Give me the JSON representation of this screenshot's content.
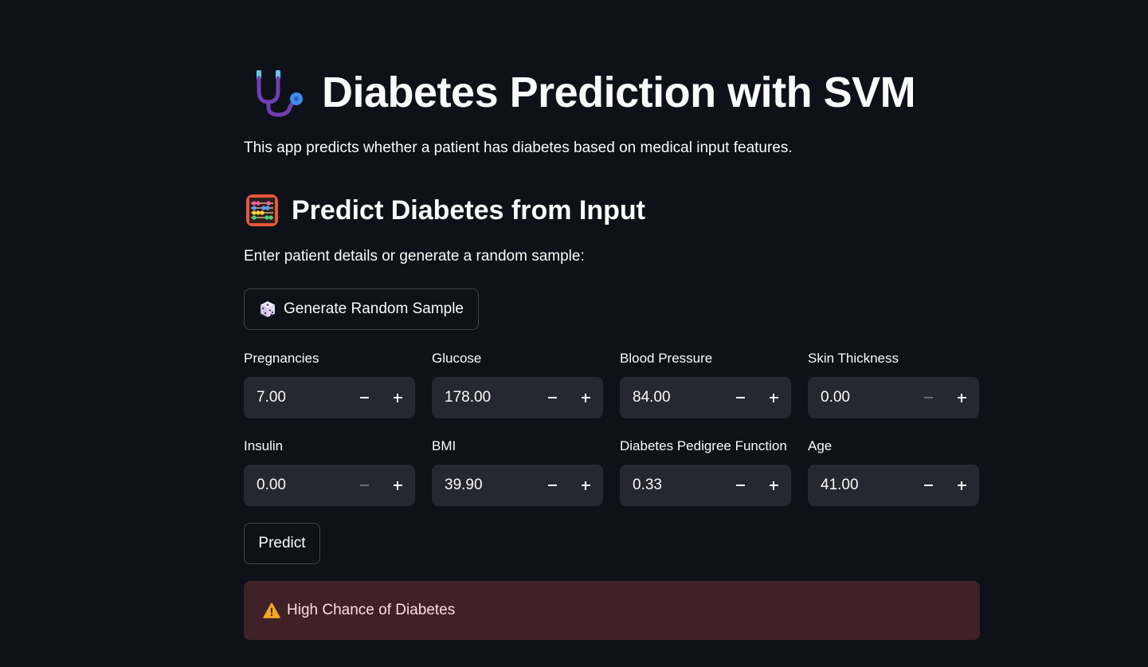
{
  "header": {
    "title": "Diabetes Prediction with SVM",
    "title_icon": "stethoscope-icon",
    "intro": "This app predicts whether a patient has diabetes based on medical input features."
  },
  "section": {
    "title": "Predict Diabetes from Input",
    "title_icon": "abacus-icon",
    "instructions": "Enter patient details or generate a random sample:"
  },
  "buttons": {
    "random_label": "Generate Random Sample",
    "random_icon": "dice-icon",
    "predict_label": "Predict"
  },
  "fields": [
    {
      "label": "Pregnancies",
      "value": "7.00",
      "minus_disabled": false
    },
    {
      "label": "Glucose",
      "value": "178.00",
      "minus_disabled": false
    },
    {
      "label": "Blood Pressure",
      "value": "84.00",
      "minus_disabled": false
    },
    {
      "label": "Skin Thickness",
      "value": "0.00",
      "minus_disabled": true
    },
    {
      "label": "Insulin",
      "value": "0.00",
      "minus_disabled": true
    },
    {
      "label": "BMI",
      "value": "39.90",
      "minus_disabled": false
    },
    {
      "label": "Diabetes Pedigree Function",
      "value": "0.33",
      "minus_disabled": false
    },
    {
      "label": "Age",
      "value": "41.00",
      "minus_disabled": false
    }
  ],
  "result": {
    "text": "High Chance of Diabetes",
    "icon": "warning-icon",
    "background": "#3e2227"
  },
  "colors": {
    "page_background": "#0e1117",
    "input_background": "#262730",
    "text": "#fafafa"
  }
}
